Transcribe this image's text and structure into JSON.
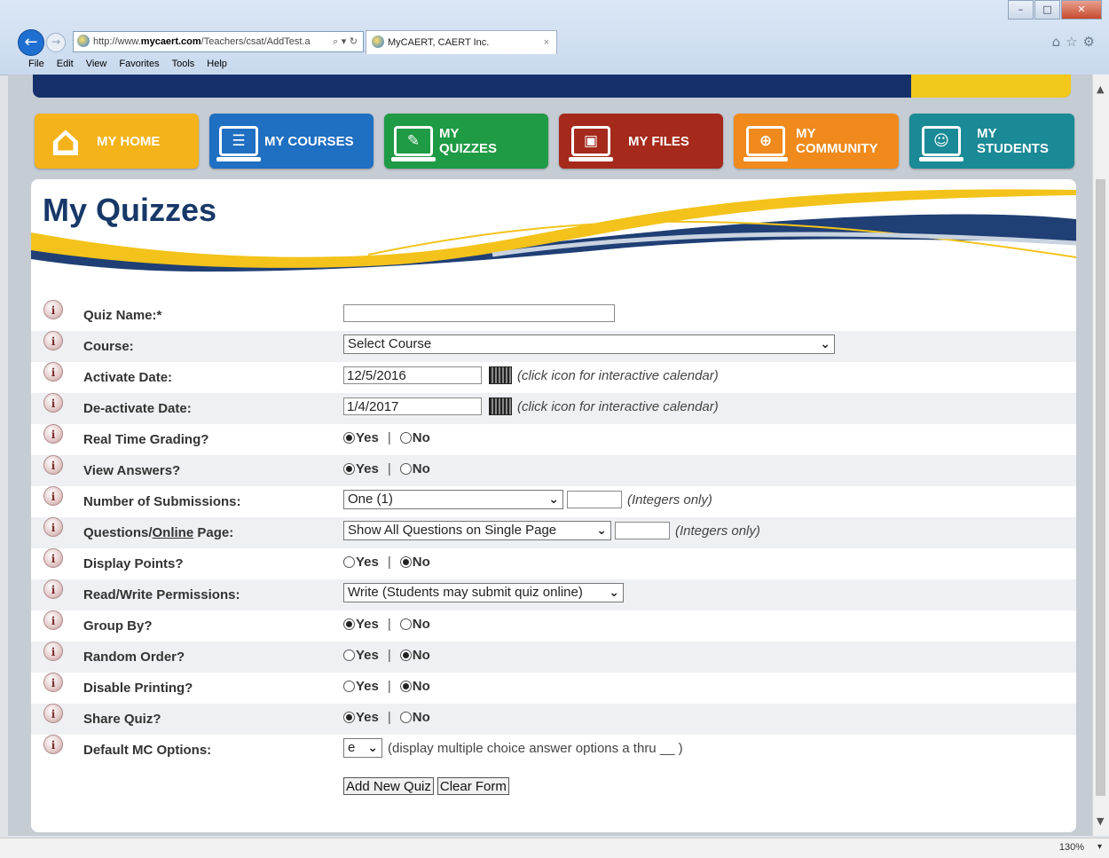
{
  "browser": {
    "url_prefix": "http://www.",
    "url_domain": "mycaert.com",
    "url_path": "/Teachers/csat/AddTest.a",
    "tab_title": "MyCAERT, CAERT Inc.",
    "menu": [
      "File",
      "Edit",
      "View",
      "Favorites",
      "Tools",
      "Help"
    ],
    "zoom": "130%"
  },
  "nav_tiles": [
    {
      "label": "MY HOME",
      "color": "#f4b31a",
      "icon": "home-icon"
    },
    {
      "label": "MY COURSES",
      "color": "#1f6fc2",
      "icon": "courses-icon"
    },
    {
      "label": "MY QUIZZES",
      "color": "#1f9a45",
      "icon": "quizzes-icon"
    },
    {
      "label": "MY FILES",
      "color": "#a52a1c",
      "icon": "files-icon"
    },
    {
      "label": "MY COMMUNITY",
      "color": "#f08a1c",
      "icon": "community-icon"
    },
    {
      "label": "MY STUDENTS",
      "color": "#1a8a96",
      "icon": "students-icon"
    }
  ],
  "page": {
    "title": "My Quizzes"
  },
  "form": {
    "quiz_name": {
      "label": "Quiz Name:*",
      "value": ""
    },
    "course": {
      "label": "Course:",
      "value": "Select Course"
    },
    "activate": {
      "label": "Activate Date:",
      "value": "12/5/2016",
      "hint": "(click icon for interactive calendar)"
    },
    "deactivate": {
      "label": "De-activate Date:",
      "value": "1/4/2017",
      "hint": "(click icon for interactive calendar)"
    },
    "realtime": {
      "label": "Real Time Grading?",
      "selected": "Yes"
    },
    "view_answers": {
      "label": "View Answers?",
      "selected": "Yes"
    },
    "submissions": {
      "label": "Number of Submissions:",
      "value": "One (1)",
      "hint": "(Integers only)"
    },
    "questions_page": {
      "label_pre": "Questions/",
      "label_link": "Online",
      "label_post": " Page:",
      "value": "Show All Questions on Single Page",
      "hint": "(Integers only)"
    },
    "display_points": {
      "label": "Display Points?",
      "selected": "No"
    },
    "permissions": {
      "label": "Read/Write Permissions:",
      "value": "Write (Students may submit quiz online)"
    },
    "group_by": {
      "label": "Group By?",
      "selected": "Yes"
    },
    "random_order": {
      "label": "Random Order?",
      "selected": "No"
    },
    "disable_printing": {
      "label": "Disable Printing?",
      "selected": "No"
    },
    "share_quiz": {
      "label": "Share Quiz?",
      "selected": "Yes"
    },
    "default_mc": {
      "label": "Default MC Options:",
      "value": "e",
      "hint": "(display multiple choice answer options a thru __ )"
    },
    "yes_label": "Yes",
    "no_label": "No",
    "add_button": "Add New Quiz",
    "clear_button": "Clear Form"
  }
}
